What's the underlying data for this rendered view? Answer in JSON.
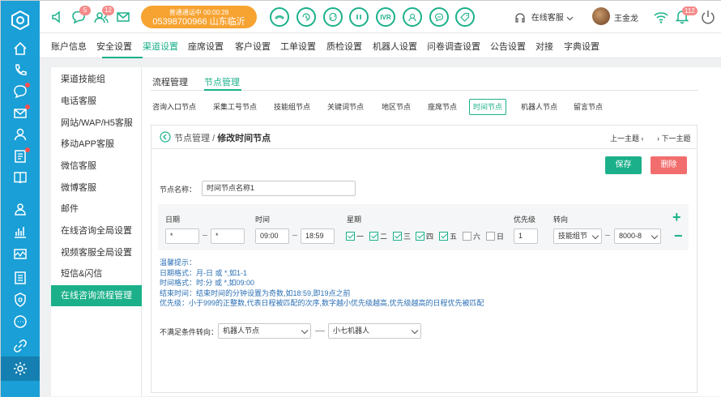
{
  "rail": {
    "logo": "hexagon-logo",
    "items": [
      "home-icon",
      "phone-icon",
      "chat-icon",
      "mail-icon",
      "users-icon",
      "doc-icon",
      "book-icon",
      "contacts-icon",
      "chart-icon",
      "monitor-icon",
      "list-icon",
      "shield-icon",
      "message-icon",
      "link-icon",
      "gear-icon"
    ]
  },
  "topbar": {
    "badges": {
      "chat": "5",
      "users": "12"
    },
    "call": {
      "status": "普通通话中 00:00:28",
      "number": "05398700966 山东临沂"
    },
    "controls": [
      "hangup-icon",
      "hold-icon",
      "transfer-icon",
      "pause-icon",
      "IVR",
      "consult-icon",
      "message-icon",
      "tag-icon"
    ],
    "ivr_label": "IVR",
    "agent_status": "在线客服",
    "user_name": "王金龙",
    "notify_count": "112"
  },
  "menu": {
    "items": [
      "账户信息",
      "安全设置",
      "渠道设置",
      "座席设置",
      "客户设置",
      "工单设置",
      "质检设置",
      "机器人设置",
      "问卷调查设置",
      "公告设置",
      "对接",
      "字典设置"
    ],
    "active": "渠道设置"
  },
  "sidebar": {
    "items": [
      "渠道技能组",
      "电话客服",
      "网站/WAP/H5客服",
      "移动APP客服",
      "微信客服",
      "微博客服",
      "邮件",
      "在线咨询全局设置",
      "视频客服全局设置",
      "短信&闪信",
      "在线咨询流程管理"
    ],
    "active": "在线咨询流程管理"
  },
  "subtabs": {
    "items": [
      "流程管理",
      "节点管理"
    ],
    "active": "节点管理"
  },
  "node_tabs": {
    "items": [
      "咨询入口节点",
      "采集工号节点",
      "技能组节点",
      "关键词节点",
      "地区节点",
      "座席节点",
      "时间节点",
      "机器人节点",
      "留言节点"
    ],
    "active": "时间节点"
  },
  "breadcrumb": {
    "parent": "节点管理",
    "sep": "/",
    "current": "修改时间节点"
  },
  "nav": {
    "prev": "上一主题",
    "next": "下一主题"
  },
  "buttons": {
    "save": "保存",
    "delete": "删除"
  },
  "form": {
    "name_label": "节点名称：",
    "name_value": "时间节点名称1",
    "headers": {
      "date": "日期",
      "time": "时间",
      "week": "星期",
      "priority": "优先级",
      "route": "转向"
    },
    "date_from": "*",
    "date_to": "*",
    "time_from": "09:00",
    "time_to": "18:59",
    "weekdays": [
      {
        "label": "一",
        "checked": true
      },
      {
        "label": "二",
        "checked": true
      },
      {
        "label": "三",
        "checked": true
      },
      {
        "label": "四",
        "checked": true
      },
      {
        "label": "五",
        "checked": true
      },
      {
        "label": "六",
        "checked": false
      },
      {
        "label": "日",
        "checked": false
      }
    ],
    "priority": "1",
    "route_type": "技能组节",
    "route_target": "8000-8"
  },
  "tips": {
    "title": "温馨提示：",
    "lines": [
      "日期格式：月-日 或 *,如1-1",
      "时间格式：时:分 或 *,如09:00",
      "结束时间：结束时间的分钟设置为奇数,如18:59,即19点之前",
      "优先级：小于999的正整数,代表日程被匹配的次序,数字越小优先级越高,优先级越高的日程优先被匹配"
    ]
  },
  "fallback": {
    "label": "不满足条件转向：",
    "type": "机器人节点",
    "target": "小七机器人"
  },
  "colors": {
    "rail": "#1a9fd6",
    "accent": "#1bb08a",
    "call": "#f7a332",
    "danger": "#f26e6e"
  }
}
